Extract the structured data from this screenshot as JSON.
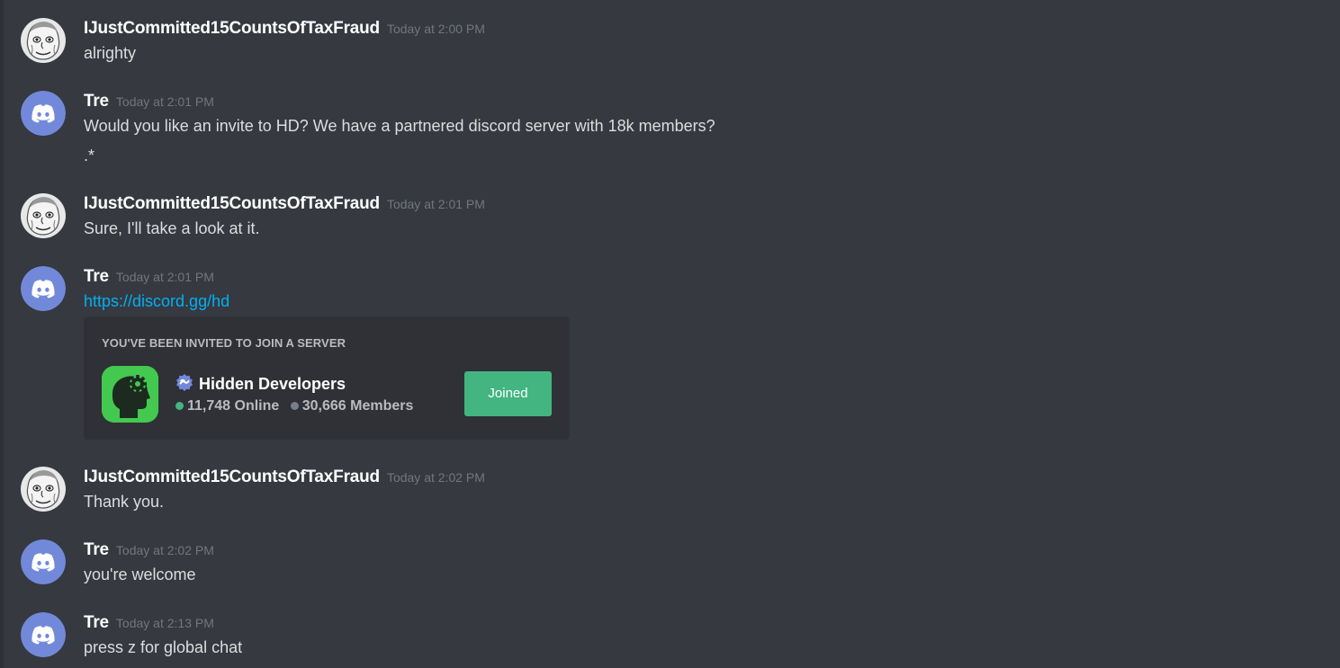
{
  "colors": {
    "background": "#36393f",
    "card": "#2f3136",
    "username": "#ffffff",
    "timestamp": "#72767d",
    "message": "#dcddde",
    "link": "#00b0f4",
    "discord_avatar": "#7289da",
    "joined_button": "#43b581",
    "online_dot": "#43b581",
    "members_dot": "#747f8d",
    "server_icon": "#43c94f"
  },
  "messages": [
    {
      "author": "IJustCommitted15CountsOfTaxFraud",
      "avatar": "sketch-face-avatar",
      "timestamp": "Today at 2:00 PM",
      "lines": [
        "alrighty"
      ]
    },
    {
      "author": "Tre",
      "avatar": "discord-logo-avatar",
      "timestamp": "Today at 2:01 PM",
      "lines": [
        "Would you like an invite to HD? We have a partnered discord server with 18k members?",
        ".*"
      ]
    },
    {
      "author": "IJustCommitted15CountsOfTaxFraud",
      "avatar": "sketch-face-avatar",
      "timestamp": "Today at 2:01 PM",
      "lines": [
        "Sure, I'll take a look at it."
      ]
    },
    {
      "author": "Tre",
      "avatar": "discord-logo-avatar",
      "timestamp": "Today at 2:01 PM",
      "link": "https://discord.gg/hd",
      "invite": {
        "title": "YOU'VE BEEN INVITED TO JOIN A SERVER",
        "server_icon": "head-gear-icon",
        "server_name": "Hidden Developers",
        "online": "11,748 Online",
        "members": "30,666 Members",
        "button_label": "Joined"
      }
    },
    {
      "author": "IJustCommitted15CountsOfTaxFraud",
      "avatar": "sketch-face-avatar",
      "timestamp": "Today at 2:02 PM",
      "lines": [
        "Thank you."
      ]
    },
    {
      "author": "Tre",
      "avatar": "discord-logo-avatar",
      "timestamp": "Today at 2:02 PM",
      "lines": [
        "you're welcome"
      ]
    },
    {
      "author": "Tre",
      "avatar": "discord-logo-avatar",
      "timestamp": "Today at 2:13 PM",
      "lines": [
        "press z for global chat"
      ]
    }
  ]
}
